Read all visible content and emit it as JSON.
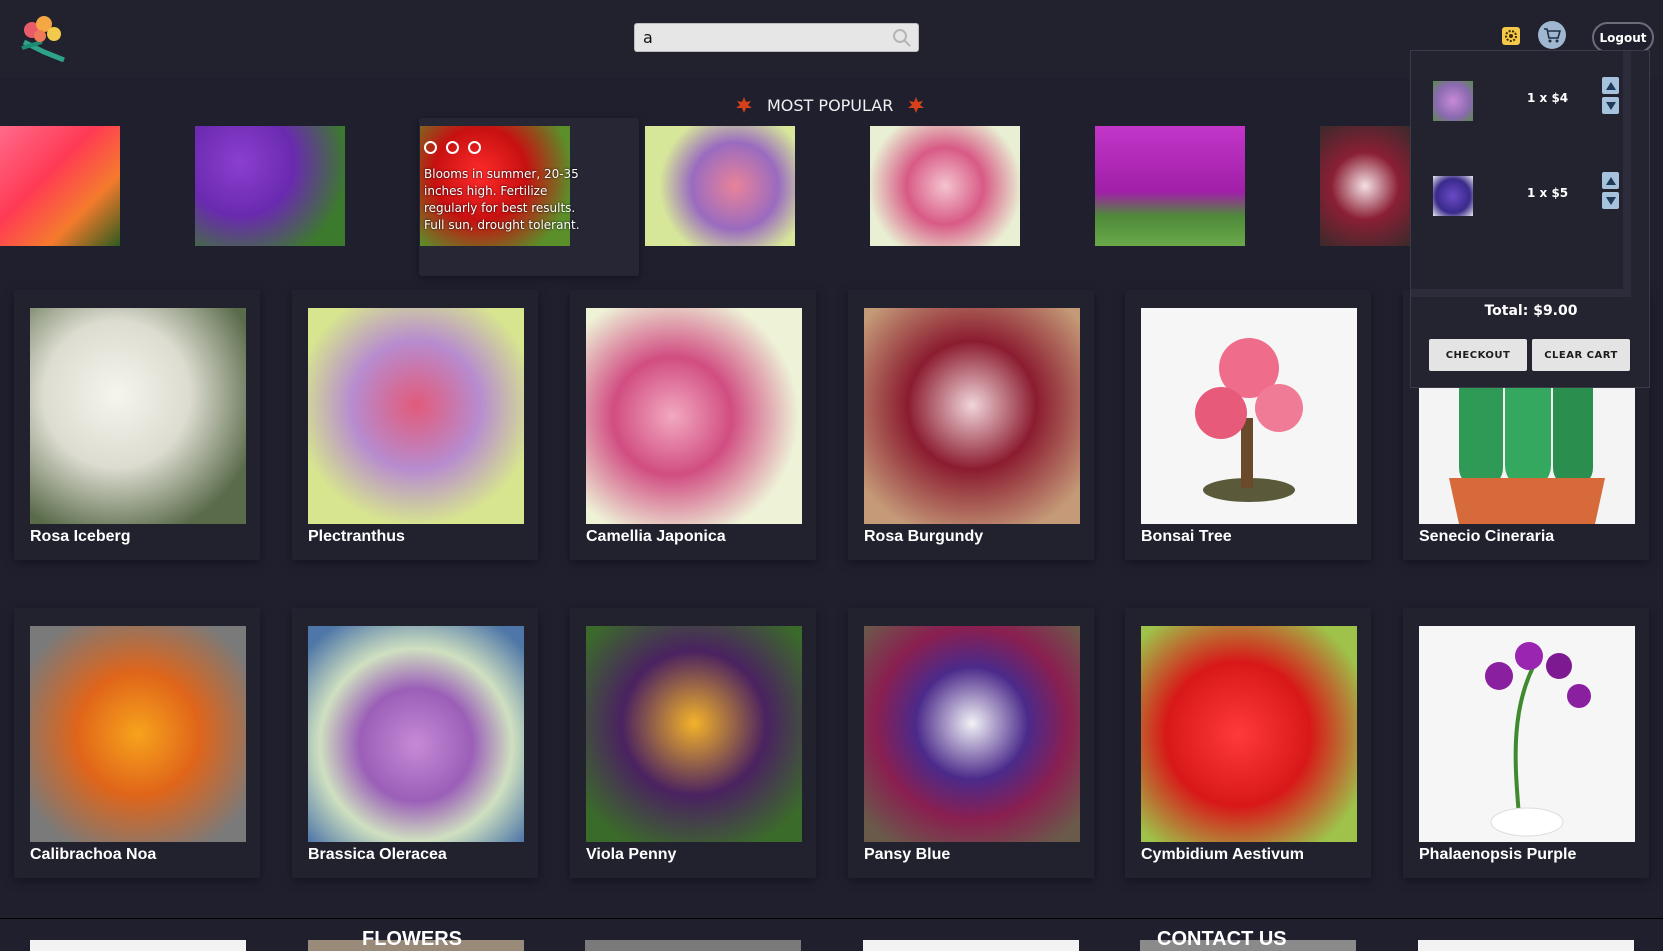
{
  "header": {
    "search": {
      "value": "a",
      "placeholder": ""
    },
    "logout_label": "Logout"
  },
  "popular": {
    "title": "MOST POPULAR",
    "tooltip": "Blooms in summer, 20-35 inches high. Fertilize regularly for best results. Full sun, drought tolerant."
  },
  "products_row1": [
    {
      "name": "Rosa Iceberg"
    },
    {
      "name": "Plectranthus"
    },
    {
      "name": "Camellia Japonica"
    },
    {
      "name": "Rosa Burgundy"
    },
    {
      "name": "Bonsai Tree"
    },
    {
      "name": "Senecio Cineraria"
    }
  ],
  "products_row2": [
    {
      "name": "Calibrachoa Noa"
    },
    {
      "name": "Brassica Oleracea"
    },
    {
      "name": "Viola Penny"
    },
    {
      "name": "Pansy Blue"
    },
    {
      "name": "Cymbidium Aestivum"
    },
    {
      "name": "Phalaenopsis Purple"
    }
  ],
  "cart": {
    "items": [
      {
        "qty_text": "1 x $4"
      },
      {
        "qty_text": "1 x $5"
      }
    ],
    "total": "Total: $9.00",
    "checkout_label": "CHECKOUT",
    "clear_label": "CLEAR CART"
  },
  "footer": {
    "flowers_label": "FLOWERS",
    "contact_label": "CONTACT US"
  },
  "colors": {
    "background": "#1f1f2e",
    "header": "#22222f",
    "accent_gear": "#f5c84a",
    "cart_button": "#9fb8cf"
  }
}
